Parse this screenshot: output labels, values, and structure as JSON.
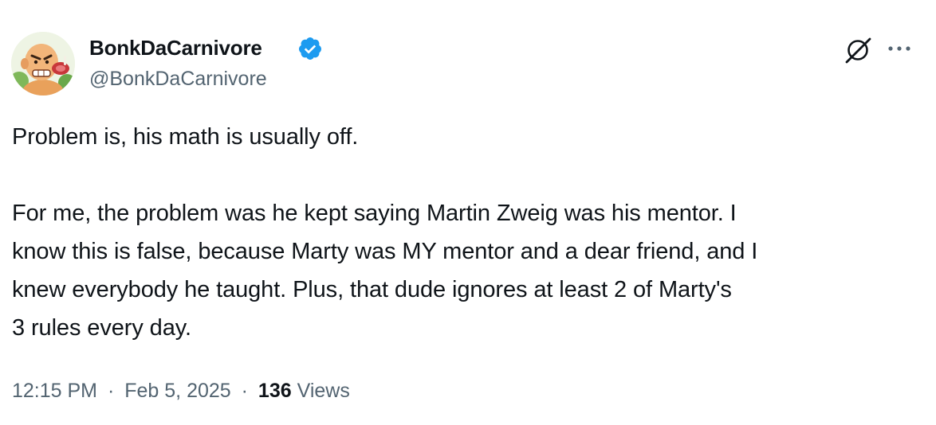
{
  "author": {
    "display_name": "BonkDaCarnivore",
    "handle": "@BonkDaCarnivore",
    "verified": true,
    "verified_color": "#1d9bf0"
  },
  "header_icons": {
    "grok": "grok-icon",
    "more": "more-options-icon"
  },
  "tweet": {
    "paragraph1": "Problem is, his math is usually off.",
    "paragraph2_lines": [
      "For me, the problem was he kept saying Martin Zweig was his mentor.  I",
      "know this is false, because Marty was MY mentor and a dear friend, and I",
      "knew everybody he taught.  Plus, that dude ignores at least 2 of Marty's",
      "3 rules every day."
    ]
  },
  "meta": {
    "time": "12:15 PM",
    "date": "Feb 5, 2025",
    "separator": "·",
    "views_count": "136",
    "views_label": "Views"
  },
  "colors": {
    "text_primary": "#0f1419",
    "text_secondary": "#536471",
    "background": "#ffffff"
  }
}
